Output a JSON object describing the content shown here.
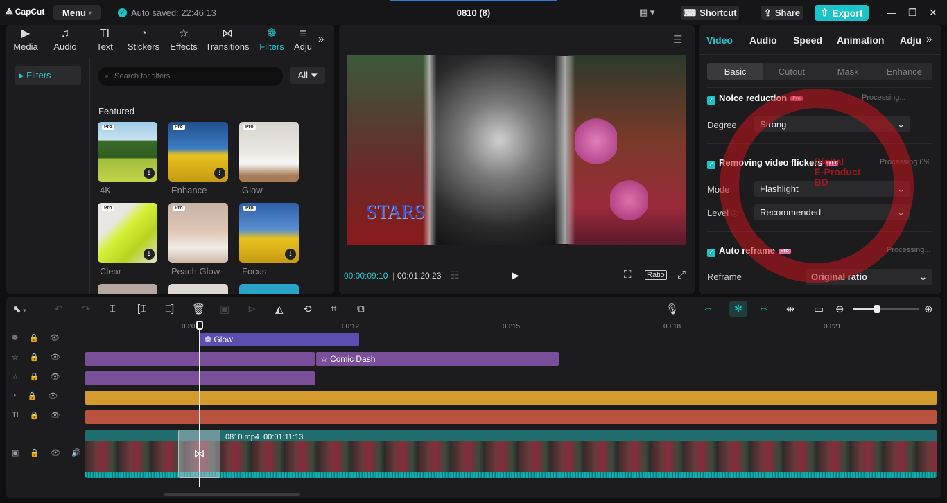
{
  "app": {
    "logo": "CapCut",
    "menu": "Menu",
    "autosave": "Auto saved: 22:46:13",
    "title": "0810 (8)",
    "shortcut": "Shortcut",
    "share": "Share",
    "export": "Export"
  },
  "left_tabs": [
    {
      "label": "Media",
      "icon": "media-icon"
    },
    {
      "label": "Audio",
      "icon": "audio-icon"
    },
    {
      "label": "Text",
      "icon": "text-icon"
    },
    {
      "label": "Stickers",
      "icon": "stickers-icon"
    },
    {
      "label": "Effects",
      "icon": "effects-icon"
    },
    {
      "label": "Transitions",
      "icon": "transitions-icon"
    },
    {
      "label": "Filters",
      "icon": "filters-icon",
      "active": true
    },
    {
      "label": "Adju",
      "icon": "adjust-icon"
    }
  ],
  "filters": {
    "side_item": "Filters",
    "search_placeholder": "Search for filters",
    "all": "All",
    "section": "Featured",
    "items": [
      {
        "label": "4K",
        "pro": "Pro"
      },
      {
        "label": "Enhance",
        "pro": "Pro"
      },
      {
        "label": "Glow",
        "pro": "Pro"
      },
      {
        "label": "Clear",
        "pro": "Pro"
      },
      {
        "label": "Peach Glow",
        "pro": "Pro"
      },
      {
        "label": "Focus",
        "pro": "Pro"
      }
    ]
  },
  "player": {
    "current": "00:00:09:10",
    "total": "00:01:20:23",
    "ratio": "Ratio",
    "overlay_text": "STARS"
  },
  "right": {
    "tabs": [
      "Video",
      "Audio",
      "Speed",
      "Animation",
      "Adju"
    ],
    "segments": [
      "Basic",
      "Cutout",
      "Mask",
      "Enhance"
    ],
    "noise": {
      "title": "Noice reduction",
      "pro": "Pro",
      "status": "Processing...",
      "degree_label": "Degree",
      "degree_value": "Strong"
    },
    "flicker": {
      "title": "Removing video flickers",
      "pro": "Pro",
      "status": "Processing 0%",
      "mode_label": "Mode",
      "mode_value": "Flashlight",
      "level_label": "Level",
      "level_value": "Recommended"
    },
    "reframe": {
      "title": "Auto reframe",
      "pro": "Pro",
      "status": "Processing...",
      "reframe_label": "Reframe",
      "reframe_value": "Original ratio"
    },
    "watermark": [
      "Digital",
      "E-Product",
      "BD"
    ]
  },
  "timeline": {
    "ticks": [
      "00:09",
      "00:12",
      "00:15",
      "00:18",
      "00:21"
    ],
    "clips": {
      "glow": "Glow",
      "comic": "Comic Dash",
      "video_name": "0810.mp4",
      "video_duration": "00:01:11:13"
    },
    "colors": {
      "purple": "#7a4f9a",
      "glow": "#5a4fb0",
      "orange": "#d39a2e",
      "red": "#b8523f",
      "teal": "#1f6d6d",
      "accent": "#19c3c7"
    }
  }
}
